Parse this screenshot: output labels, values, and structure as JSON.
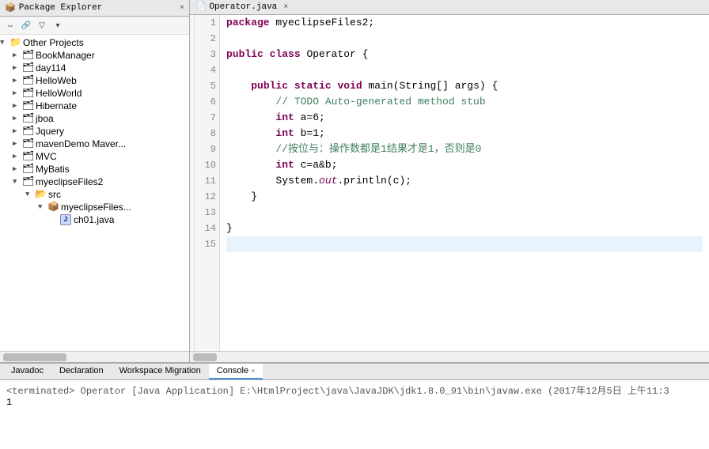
{
  "packageExplorer": {
    "tabLabel": "Package Explorer",
    "tabClose": "×",
    "toolbar": [
      "⇒",
      "▽",
      "◁",
      "▷"
    ],
    "tree": [
      {
        "id": "other-projects",
        "indent": 0,
        "arrow": "▼",
        "icon": "📁",
        "iconType": "root",
        "label": "Other Projects",
        "expanded": true
      },
      {
        "id": "bookmanager",
        "indent": 1,
        "arrow": "▶",
        "icon": "P",
        "iconType": "project",
        "label": "BookManager"
      },
      {
        "id": "day114",
        "indent": 1,
        "arrow": "▶",
        "icon": "P",
        "iconType": "project",
        "label": "day114"
      },
      {
        "id": "helloweb",
        "indent": 1,
        "arrow": "▶",
        "icon": "P",
        "iconType": "project",
        "label": "HelloWeb"
      },
      {
        "id": "helloworld",
        "indent": 1,
        "arrow": "▶",
        "icon": "P",
        "iconType": "project",
        "label": "HelloWorld"
      },
      {
        "id": "hibernate",
        "indent": 1,
        "arrow": "▶",
        "icon": "P",
        "iconType": "project",
        "label": "Hibernate"
      },
      {
        "id": "jboa",
        "indent": 1,
        "arrow": "▶",
        "icon": "P",
        "iconType": "project",
        "label": "jboa"
      },
      {
        "id": "jquery",
        "indent": 1,
        "arrow": "▶",
        "icon": "P",
        "iconType": "project",
        "label": "Jquery"
      },
      {
        "id": "mavendemo",
        "indent": 1,
        "arrow": "▶",
        "icon": "P",
        "iconType": "project",
        "label": "mavenDemo Maver..."
      },
      {
        "id": "mvc",
        "indent": 1,
        "arrow": "▶",
        "icon": "P",
        "iconType": "project",
        "label": "MVC"
      },
      {
        "id": "mybatis",
        "indent": 1,
        "arrow": "▶",
        "icon": "P",
        "iconType": "project",
        "label": "MyBatis"
      },
      {
        "id": "myeclipsefiles2",
        "indent": 1,
        "arrow": "▼",
        "icon": "P",
        "iconType": "project",
        "label": "myeclipseFiles2",
        "expanded": true
      },
      {
        "id": "src",
        "indent": 2,
        "arrow": "▼",
        "icon": "📂",
        "iconType": "src",
        "label": "src",
        "expanded": true
      },
      {
        "id": "myeclipsefiles-pkg",
        "indent": 3,
        "arrow": "▼",
        "icon": "📦",
        "iconType": "package",
        "label": "myeclipseFiles...",
        "expanded": true
      },
      {
        "id": "ch01java",
        "indent": 4,
        "arrow": " ",
        "icon": "J",
        "iconType": "class",
        "label": "ch01.java"
      }
    ]
  },
  "editor": {
    "tabLabel": "Operator.java",
    "tabClose": "×",
    "lines": [
      {
        "num": 1,
        "code": "package myeclipseFiles2;",
        "tokens": [
          {
            "text": "package",
            "type": "kw"
          },
          {
            "text": " myeclipseFiles2;",
            "type": "plain"
          }
        ]
      },
      {
        "num": 2,
        "code": "",
        "tokens": []
      },
      {
        "num": 3,
        "code": "public class Operator {",
        "tokens": [
          {
            "text": "public",
            "type": "kw"
          },
          {
            "text": " ",
            "type": "plain"
          },
          {
            "text": "class",
            "type": "kw"
          },
          {
            "text": " Operator {",
            "type": "plain"
          }
        ]
      },
      {
        "num": 4,
        "code": "",
        "tokens": []
      },
      {
        "num": 5,
        "code": "    public static void main(String[] args) {",
        "tokens": [
          {
            "text": "    ",
            "type": "plain"
          },
          {
            "text": "public",
            "type": "kw"
          },
          {
            "text": " ",
            "type": "plain"
          },
          {
            "text": "static",
            "type": "kw"
          },
          {
            "text": " ",
            "type": "plain"
          },
          {
            "text": "void",
            "type": "kw"
          },
          {
            "text": " main(String[] args) {",
            "type": "plain"
          }
        ]
      },
      {
        "num": 6,
        "code": "        // TODO Auto-generated method stub",
        "tokens": [
          {
            "text": "        // TODO Auto-generated method stub",
            "type": "comment"
          }
        ]
      },
      {
        "num": 7,
        "code": "        int a=6;",
        "tokens": [
          {
            "text": "        ",
            "type": "plain"
          },
          {
            "text": "int",
            "type": "kw"
          },
          {
            "text": " a=6;",
            "type": "plain"
          }
        ]
      },
      {
        "num": 8,
        "code": "        int b=1;",
        "tokens": [
          {
            "text": "        ",
            "type": "plain"
          },
          {
            "text": "int",
            "type": "kw"
          },
          {
            "text": " b=1;",
            "type": "plain"
          }
        ]
      },
      {
        "num": 9,
        "code": "        //按位与：操作数都是1结果才是1，否则是0",
        "tokens": [
          {
            "text": "        //按位与：操作数都是1结果才是1，否则是0",
            "type": "comment"
          }
        ]
      },
      {
        "num": 10,
        "code": "        int c=a&b;",
        "tokens": [
          {
            "text": "        ",
            "type": "plain"
          },
          {
            "text": "int",
            "type": "kw"
          },
          {
            "text": " c=a&b;",
            "type": "plain"
          }
        ]
      },
      {
        "num": 11,
        "code": "        System.out.println(c);",
        "tokens": [
          {
            "text": "        System.",
            "type": "plain"
          },
          {
            "text": "out",
            "type": "out"
          },
          {
            "text": ".println(c);",
            "type": "plain"
          }
        ]
      },
      {
        "num": 12,
        "code": "    }",
        "tokens": [
          {
            "text": "    }",
            "type": "plain"
          }
        ]
      },
      {
        "num": 13,
        "code": "",
        "tokens": []
      },
      {
        "num": 14,
        "code": "}",
        "tokens": [
          {
            "text": "}",
            "type": "plain"
          }
        ]
      },
      {
        "num": 15,
        "code": "",
        "tokens": [],
        "active": true
      }
    ]
  },
  "bottomPanel": {
    "tabs": [
      {
        "id": "javadoc",
        "label": "Javadoc",
        "active": false,
        "closeable": false
      },
      {
        "id": "declaration",
        "label": "Declaration",
        "active": false,
        "closeable": false
      },
      {
        "id": "workspace-migration",
        "label": "Workspace Migration",
        "active": false,
        "closeable": false
      },
      {
        "id": "console",
        "label": "Console",
        "active": true,
        "closeable": true
      }
    ],
    "consoleLines": [
      {
        "id": "terminated",
        "text": "<terminated> Operator [Java Application] E:\\HtmlProject\\java\\JavaJDK\\jdk1.8.0_91\\bin\\javaw.exe (2017年12月5日 上午11:3",
        "type": "terminated"
      },
      {
        "id": "output",
        "text": "1",
        "type": "output"
      }
    ]
  }
}
